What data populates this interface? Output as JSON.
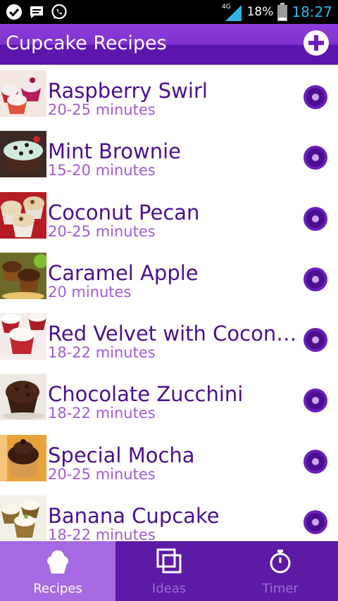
{
  "status_bar": {
    "network": "4G",
    "battery": "18%",
    "time": "18:27",
    "icons": [
      "check-icon",
      "chat-icon",
      "whatsapp-icon",
      "signal-icon",
      "battery-icon"
    ]
  },
  "app_bar": {
    "title": "Cupcake Recipes",
    "add_icon": "plus-icon"
  },
  "recipes": [
    {
      "name": "Raspberry Swirl",
      "time": "20-25 minutes"
    },
    {
      "name": "Mint Brownie",
      "time": "15-20 minutes"
    },
    {
      "name": "Coconut Pecan",
      "time": "20-25 minutes"
    },
    {
      "name": "Caramel Apple",
      "time": "20 minutes"
    },
    {
      "name": "Red Velvet with Coconut…",
      "time": "18-22 minutes"
    },
    {
      "name": "Chocolate Zucchini",
      "time": "18-22 minutes"
    },
    {
      "name": "Special Mocha",
      "time": "20-25 minutes"
    },
    {
      "name": "Banana Cupcake",
      "time": "18-22 minutes"
    }
  ],
  "tabs": [
    {
      "label": "Recipes",
      "icon": "cupcake-icon",
      "active": true
    },
    {
      "label": "Ideas",
      "icon": "copy-icon",
      "active": false
    },
    {
      "label": "Timer",
      "icon": "stopwatch-icon",
      "active": false
    }
  ],
  "colors": {
    "accent": "#5c1aa5",
    "active_tab": "#a56ae3",
    "title_text": "#4b0f8f",
    "subtitle_text": "#a25ad8",
    "clock": "#33b5e5"
  }
}
